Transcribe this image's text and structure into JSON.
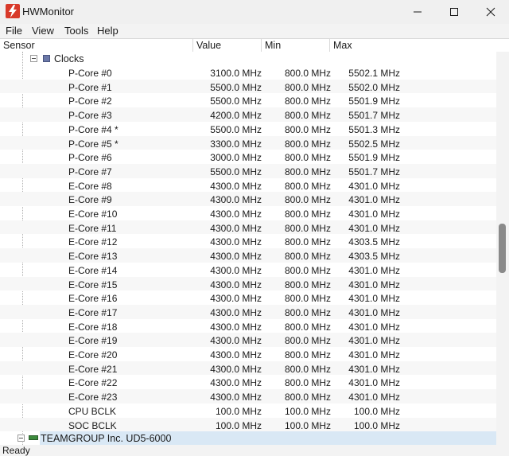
{
  "window": {
    "title": "HWMonitor"
  },
  "menu": [
    "File",
    "View",
    "Tools",
    "Help"
  ],
  "columns": [
    "Sensor",
    "Value",
    "Min",
    "Max"
  ],
  "group": {
    "label": "Clocks"
  },
  "rows": [
    {
      "name": "P-Core #0",
      "value": "3100.0 MHz",
      "min": "800.0 MHz",
      "max": "5502.1 MHz"
    },
    {
      "name": "P-Core #1",
      "value": "5500.0 MHz",
      "min": "800.0 MHz",
      "max": "5502.0 MHz"
    },
    {
      "name": "P-Core #2",
      "value": "5500.0 MHz",
      "min": "800.0 MHz",
      "max": "5501.9 MHz"
    },
    {
      "name": "P-Core #3",
      "value": "4200.0 MHz",
      "min": "800.0 MHz",
      "max": "5501.7 MHz"
    },
    {
      "name": "P-Core #4 *",
      "value": "5500.0 MHz",
      "min": "800.0 MHz",
      "max": "5501.3 MHz"
    },
    {
      "name": "P-Core #5 *",
      "value": "3300.0 MHz",
      "min": "800.0 MHz",
      "max": "5502.5 MHz"
    },
    {
      "name": "P-Core #6",
      "value": "3000.0 MHz",
      "min": "800.0 MHz",
      "max": "5501.9 MHz"
    },
    {
      "name": "P-Core #7",
      "value": "5500.0 MHz",
      "min": "800.0 MHz",
      "max": "5501.7 MHz"
    },
    {
      "name": "E-Core #8",
      "value": "4300.0 MHz",
      "min": "800.0 MHz",
      "max": "4301.0 MHz"
    },
    {
      "name": "E-Core #9",
      "value": "4300.0 MHz",
      "min": "800.0 MHz",
      "max": "4301.0 MHz"
    },
    {
      "name": "E-Core #10",
      "value": "4300.0 MHz",
      "min": "800.0 MHz",
      "max": "4301.0 MHz"
    },
    {
      "name": "E-Core #11",
      "value": "4300.0 MHz",
      "min": "800.0 MHz",
      "max": "4301.0 MHz"
    },
    {
      "name": "E-Core #12",
      "value": "4300.0 MHz",
      "min": "800.0 MHz",
      "max": "4303.5 MHz"
    },
    {
      "name": "E-Core #13",
      "value": "4300.0 MHz",
      "min": "800.0 MHz",
      "max": "4303.5 MHz"
    },
    {
      "name": "E-Core #14",
      "value": "4300.0 MHz",
      "min": "800.0 MHz",
      "max": "4301.0 MHz"
    },
    {
      "name": "E-Core #15",
      "value": "4300.0 MHz",
      "min": "800.0 MHz",
      "max": "4301.0 MHz"
    },
    {
      "name": "E-Core #16",
      "value": "4300.0 MHz",
      "min": "800.0 MHz",
      "max": "4301.0 MHz"
    },
    {
      "name": "E-Core #17",
      "value": "4300.0 MHz",
      "min": "800.0 MHz",
      "max": "4301.0 MHz"
    },
    {
      "name": "E-Core #18",
      "value": "4300.0 MHz",
      "min": "800.0 MHz",
      "max": "4301.0 MHz"
    },
    {
      "name": "E-Core #19",
      "value": "4300.0 MHz",
      "min": "800.0 MHz",
      "max": "4301.0 MHz"
    },
    {
      "name": "E-Core #20",
      "value": "4300.0 MHz",
      "min": "800.0 MHz",
      "max": "4301.0 MHz"
    },
    {
      "name": "E-Core #21",
      "value": "4300.0 MHz",
      "min": "800.0 MHz",
      "max": "4301.0 MHz"
    },
    {
      "name": "E-Core #22",
      "value": "4300.0 MHz",
      "min": "800.0 MHz",
      "max": "4301.0 MHz"
    },
    {
      "name": "E-Core #23",
      "value": "4300.0 MHz",
      "min": "800.0 MHz",
      "max": "4301.0 MHz"
    },
    {
      "name": "CPU BCLK",
      "value": "100.0 MHz",
      "min": "100.0 MHz",
      "max": "100.0 MHz"
    },
    {
      "name": "SOC BCLK",
      "value": "100.0 MHz",
      "min": "100.0 MHz",
      "max": "100.0 MHz"
    }
  ],
  "device": {
    "label": "TEAMGROUP Inc. UD5-6000"
  },
  "status": {
    "text": "Ready"
  },
  "icons": {
    "app": "hwmonitor-lightning-icon",
    "minimize": "minimize-icon",
    "maximize": "maximize-icon",
    "close": "close-icon",
    "group": "clock-sensor-icon",
    "device": "ram-module-icon"
  },
  "colors": {
    "app_icon": "#d83a2a",
    "selection": "#d9e8f5",
    "scroll_thumb": "#8a8a8a"
  }
}
